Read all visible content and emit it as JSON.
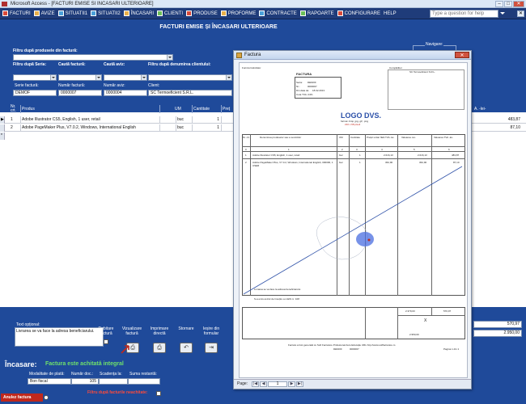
{
  "app": {
    "title": "Microsoft Access - [FACTURI EMISE SI INCASARI ULTERIOARE]"
  },
  "menu": {
    "items": [
      "FACTURI",
      "AVIZE",
      "SITUATII1",
      "SITUATII2",
      "ÎNCASARI",
      "CLIENTI",
      "PRODUSE",
      "PROFORME",
      "CONTRACTE",
      "RAPOARTE",
      "CONFIGURARE",
      "HELP"
    ],
    "ask_placeholder": "Type a question for help"
  },
  "form": {
    "title": "FACTURI EMISE ȘI ÎNCASARI ULTERIOARE",
    "filter_product_label": "Filtru după produsele din factură:",
    "filter_series_label": "Filtru după Seria:",
    "search_invoice_label": "Caută factură:",
    "search_aviz_label": "Caută aviz:",
    "filter_client_label": "Filtru după denumirea clientului:",
    "navigation_label": "Navigare:",
    "series_label": "Serie factură:",
    "series_value": "DEMOF",
    "invoice_no_label": "Număr factură:",
    "invoice_no_value": "0000007",
    "aviz_no_label": "Număr aviz:",
    "aviz_no_value": "0000004",
    "client_label": "Client:",
    "client_value": "SC Termoeficient S.R.L."
  },
  "grid": {
    "headers": {
      "nr": "Nr. crt.",
      "product": "Produs",
      "um": "UM",
      "qty": "Cantitate",
      "price": "Preț",
      "total": "A. -lei-"
    },
    "rows": [
      {
        "nr": "1",
        "product": "Adobe Illustrator CS5, English, 1 user, retail",
        "um": "buc",
        "qty": "1",
        "total": "483,87"
      },
      {
        "nr": "2",
        "product": "Adobe PageMaker Plus, V7.0.2, Windows, International English",
        "um": "buc",
        "qty": "1",
        "total": "87,10"
      }
    ],
    "sum1": "570,97",
    "sum2": "2.950,00"
  },
  "bottom": {
    "notes_label": "Text opțional:",
    "notes_value": "Livrarea se va face la adresa beneficiarului.",
    "debit_label": "Debitare factură",
    "view_label": "Vizualizare factură",
    "print_label": "Imprimare directă",
    "storno_label": "Stornare",
    "exit_label": "Ieșire din formular"
  },
  "incasare": {
    "title": "Încasare:",
    "status": "Factura este achitată integral",
    "payment_mode_label": "Modalitate de plată:",
    "doc_no_label": "Număr doc.:",
    "due_date_label": "Scadența la:",
    "remaining_label": "Suma restantă:",
    "payment_mode_value": "Bon fiscal",
    "doc_no_value": "105",
    "unpaid_filter_label": "Filtru după facturile neachitate:",
    "cancel_button": "Anulez factura"
  },
  "report": {
    "window_title": "Factura",
    "page_label": "Page:",
    "page_value": "1",
    "invoice_word": "FACTURA",
    "logo_text": "LOGO DVS.",
    "logo_sub": "format .bmp, jpg, gif, .png",
    "logo_size": "210 x 68 pixeli",
    "furnizor_label": "Furnizor/vânzător",
    "cumparator_label": "Cumpărător",
    "client_name": "SC Termoeficient S.R.L.",
    "seria_label": "Seria:",
    "seria_value": "DEMOF",
    "nr_label": "Nr.:",
    "nr_value": "0000007",
    "date_label": "Din data de:",
    "date_value": "18.02.2013",
    "tva_label": "Cota TVA: 24%",
    "table_headers": [
      "Nr. crt.",
      "Denumirea produselor sau a serviciilor",
      "UM",
      "Cantitate",
      "Prețul unitar fără TVA -lei-",
      "Valoarea -lei-",
      "Valoarea TVA -lei-"
    ],
    "table_index": [
      "0",
      "1",
      "2",
      "3",
      "4",
      "5",
      "6"
    ],
    "rows": [
      {
        "nr": "1",
        "name": "Adobe Illustrator CS5, English, 1 user, retail",
        "um": "buc",
        "qty": "1",
        "price": "2.016,13",
        "value": "2.016,13",
        "tva": "483,87"
      },
      {
        "nr": "2",
        "name": "Adobe PageMaker Plus, V7.0.2, Windows, International English, 000000, 1 USER",
        "um": "buc",
        "qty": "1",
        "price": "362,90",
        "value": "362,90",
        "tva": "87,10"
      }
    ],
    "delivery_note": "Livrarea se va face la adresa beneficiarului.",
    "aviz_note": "S-a emis avizul de însoțire a mărfii nr. 108",
    "total_value": "2.379,03",
    "total_tva": "570,97",
    "grand_total": "2.950,00",
    "footer": "Factura a fost generată cu Soft Facturare Profesional Auto Educație URL http://www.softfacturare.ro",
    "page_footer": "Pagina 1 din 1"
  }
}
